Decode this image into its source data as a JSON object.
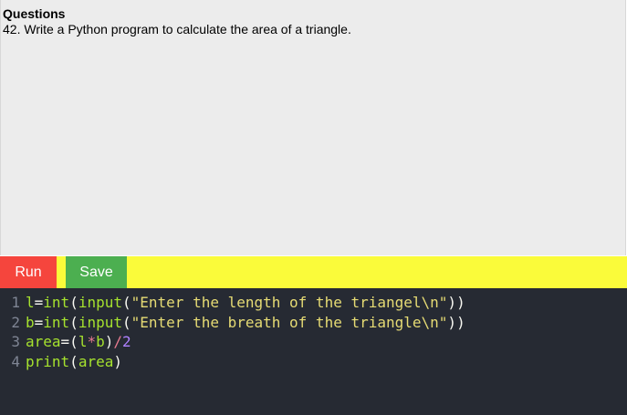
{
  "question": {
    "heading": "Questions",
    "text": "42. Write a Python program to calculate the area of a triangle."
  },
  "toolbar": {
    "run_label": "Run",
    "save_label": "Save"
  },
  "editor": {
    "lines": [
      {
        "number": "1",
        "code": "l=int(input(\"Enter the length of the triangel\\n\"))"
      },
      {
        "number": "2",
        "code": "b=int(input(\"Enter the breath of the triangle\\n\"))"
      },
      {
        "number": "3",
        "code": "area=(l*b)/2"
      },
      {
        "number": "4",
        "code": "print(area)"
      }
    ]
  },
  "colors": {
    "toolbar_bg": "#fafb3a",
    "run_button": "#f5453d",
    "save_button": "#4caf50",
    "editor_bg": "#262a33",
    "question_bg": "#ececec"
  }
}
